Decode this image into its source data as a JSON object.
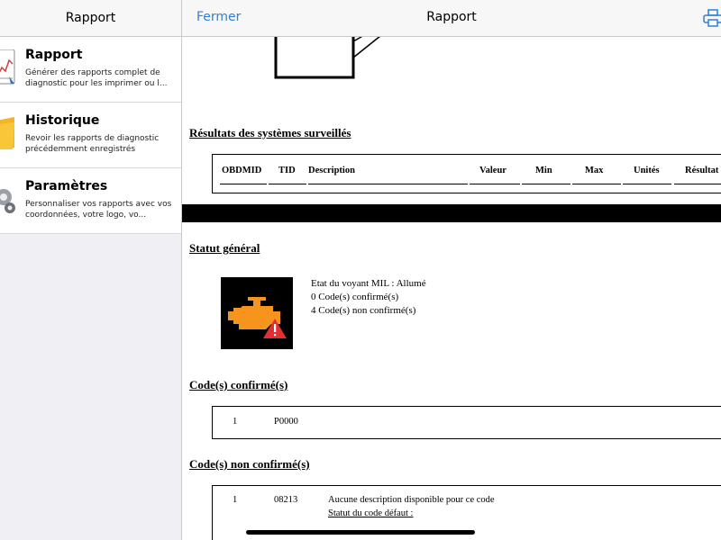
{
  "sidebar": {
    "title": "Rapport",
    "items": [
      {
        "title": "Rapport",
        "desc": "Générer des rapports complet de diagnostic pour les imprimer ou l..."
      },
      {
        "title": "Historique",
        "desc": "Revoir les rapports de diagnostic précédemment enregistrés"
      },
      {
        "title": "Paramètres",
        "desc": "Personnaliser vos rapports avec vos coordonnées, votre logo, vo..."
      }
    ]
  },
  "topbar": {
    "close_label": "Fermer",
    "title": "Rapport",
    "print_icon": "printer-icon"
  },
  "monitor_section": {
    "title": "Résultats des systèmes surveillés",
    "columns": [
      "OBDMID",
      "TID",
      "Description",
      "Valeur",
      "Min",
      "Max",
      "Unités",
      "Résultat"
    ]
  },
  "general_status": {
    "title": "Statut général",
    "icon": "check-engine-warning-icon",
    "lines": [
      "Etat du voyant MIL : Allumé",
      "0 Code(s) confirmé(s)",
      "4 Code(s) non confirmé(s)"
    ]
  },
  "confirmed": {
    "title": "Code(s) confirmé(s)",
    "rows": [
      {
        "index": "1",
        "code": "P0000"
      }
    ]
  },
  "unconfirmed": {
    "title": "Code(s) non confirmé(s)",
    "rows": [
      {
        "index": "1",
        "code": "08213",
        "desc": "Aucune description disponible pour ce code",
        "status_label": "Statut du code défaut :"
      }
    ]
  },
  "colors": {
    "accent": "#2f7fd6",
    "engine": "#f7941d",
    "warning": "#e03030"
  }
}
